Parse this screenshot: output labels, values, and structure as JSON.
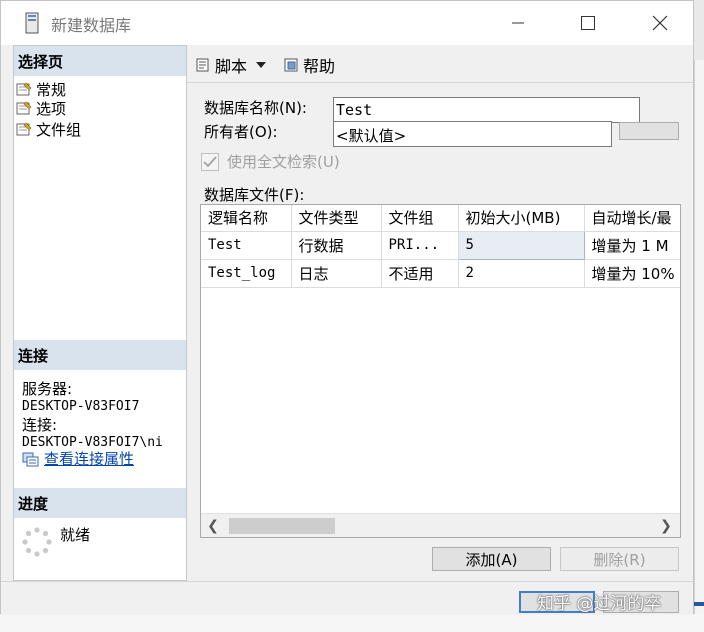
{
  "window": {
    "title": "新建数据库"
  },
  "sidebar": {
    "select_page_header": "选择页",
    "pages": [
      {
        "label": "常规",
        "icon": "page-icon"
      },
      {
        "label": "选项",
        "icon": "page-icon"
      },
      {
        "label": "文件组",
        "icon": "page-icon"
      }
    ],
    "connection_header": "连接",
    "server_label": "服务器:",
    "server_value": "DESKTOP-V83FOI7",
    "connection_label": "连接:",
    "connection_value": "DESKTOP-V83FOI7\\ni",
    "view_properties_link": "查看连接属性",
    "progress_header": "进度",
    "progress_status": "就绪"
  },
  "toolbar": {
    "script_label": "脚本",
    "help_label": "帮助"
  },
  "form": {
    "db_name_label": "数据库名称(N):",
    "db_name_value": "Test",
    "owner_label": "所有者(O):",
    "owner_value": "<默认值>",
    "fulltext_label": "使用全文检索(U)",
    "fulltext_checked": true,
    "files_label": "数据库文件(F):"
  },
  "files_table": {
    "columns": [
      "逻辑名称",
      "文件类型",
      "文件组",
      "初始大小(MB)",
      "自动增长/最"
    ],
    "rows": [
      [
        "Test",
        "行数据",
        "PRI...",
        "5",
        "增量为 1 M"
      ],
      [
        "Test_log",
        "日志",
        "不适用",
        "2",
        "增量为 10%"
      ]
    ]
  },
  "buttons": {
    "add": "添加(A)",
    "remove": "删除(R)",
    "ok": "",
    "cancel": ""
  },
  "watermark": "知乎 @过河的卒"
}
